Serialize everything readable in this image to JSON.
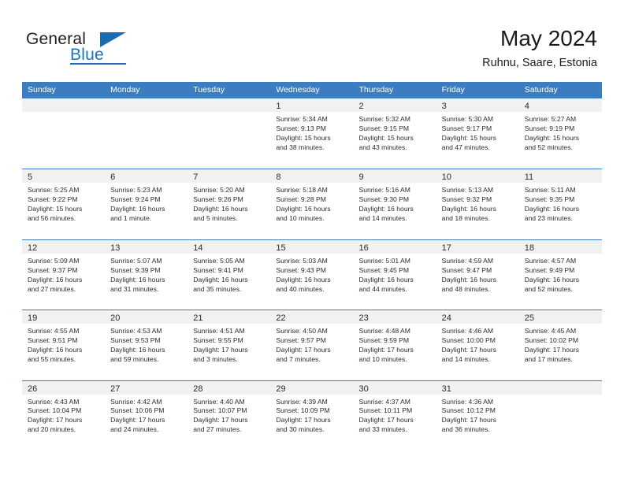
{
  "brand": {
    "name_top": "General",
    "name_bottom": "Blue",
    "accent_color": "#1b6cb0"
  },
  "header": {
    "month_title": "May 2024",
    "location": "Ruhnu, Saare, Estonia"
  },
  "theme": {
    "header_blue": "#3b7dc0",
    "day_band_gray": "#f1f1f1",
    "text": "#2b2b2b"
  },
  "weekdays": [
    "Sunday",
    "Monday",
    "Tuesday",
    "Wednesday",
    "Thursday",
    "Friday",
    "Saturday"
  ],
  "weeks": [
    [
      {
        "day": "",
        "sunrise": "",
        "sunset": "",
        "daylight_1": "",
        "daylight_2": ""
      },
      {
        "day": "",
        "sunrise": "",
        "sunset": "",
        "daylight_1": "",
        "daylight_2": ""
      },
      {
        "day": "",
        "sunrise": "",
        "sunset": "",
        "daylight_1": "",
        "daylight_2": ""
      },
      {
        "day": "1",
        "sunrise": "Sunrise: 5:34 AM",
        "sunset": "Sunset: 9:13 PM",
        "daylight_1": "Daylight: 15 hours",
        "daylight_2": "and 38 minutes."
      },
      {
        "day": "2",
        "sunrise": "Sunrise: 5:32 AM",
        "sunset": "Sunset: 9:15 PM",
        "daylight_1": "Daylight: 15 hours",
        "daylight_2": "and 43 minutes."
      },
      {
        "day": "3",
        "sunrise": "Sunrise: 5:30 AM",
        "sunset": "Sunset: 9:17 PM",
        "daylight_1": "Daylight: 15 hours",
        "daylight_2": "and 47 minutes."
      },
      {
        "day": "4",
        "sunrise": "Sunrise: 5:27 AM",
        "sunset": "Sunset: 9:19 PM",
        "daylight_1": "Daylight: 15 hours",
        "daylight_2": "and 52 minutes."
      }
    ],
    [
      {
        "day": "5",
        "sunrise": "Sunrise: 5:25 AM",
        "sunset": "Sunset: 9:22 PM",
        "daylight_1": "Daylight: 15 hours",
        "daylight_2": "and 56 minutes."
      },
      {
        "day": "6",
        "sunrise": "Sunrise: 5:23 AM",
        "sunset": "Sunset: 9:24 PM",
        "daylight_1": "Daylight: 16 hours",
        "daylight_2": "and 1 minute."
      },
      {
        "day": "7",
        "sunrise": "Sunrise: 5:20 AM",
        "sunset": "Sunset: 9:26 PM",
        "daylight_1": "Daylight: 16 hours",
        "daylight_2": "and 5 minutes."
      },
      {
        "day": "8",
        "sunrise": "Sunrise: 5:18 AM",
        "sunset": "Sunset: 9:28 PM",
        "daylight_1": "Daylight: 16 hours",
        "daylight_2": "and 10 minutes."
      },
      {
        "day": "9",
        "sunrise": "Sunrise: 5:16 AM",
        "sunset": "Sunset: 9:30 PM",
        "daylight_1": "Daylight: 16 hours",
        "daylight_2": "and 14 minutes."
      },
      {
        "day": "10",
        "sunrise": "Sunrise: 5:13 AM",
        "sunset": "Sunset: 9:32 PM",
        "daylight_1": "Daylight: 16 hours",
        "daylight_2": "and 18 minutes."
      },
      {
        "day": "11",
        "sunrise": "Sunrise: 5:11 AM",
        "sunset": "Sunset: 9:35 PM",
        "daylight_1": "Daylight: 16 hours",
        "daylight_2": "and 23 minutes."
      }
    ],
    [
      {
        "day": "12",
        "sunrise": "Sunrise: 5:09 AM",
        "sunset": "Sunset: 9:37 PM",
        "daylight_1": "Daylight: 16 hours",
        "daylight_2": "and 27 minutes."
      },
      {
        "day": "13",
        "sunrise": "Sunrise: 5:07 AM",
        "sunset": "Sunset: 9:39 PM",
        "daylight_1": "Daylight: 16 hours",
        "daylight_2": "and 31 minutes."
      },
      {
        "day": "14",
        "sunrise": "Sunrise: 5:05 AM",
        "sunset": "Sunset: 9:41 PM",
        "daylight_1": "Daylight: 16 hours",
        "daylight_2": "and 35 minutes."
      },
      {
        "day": "15",
        "sunrise": "Sunrise: 5:03 AM",
        "sunset": "Sunset: 9:43 PM",
        "daylight_1": "Daylight: 16 hours",
        "daylight_2": "and 40 minutes."
      },
      {
        "day": "16",
        "sunrise": "Sunrise: 5:01 AM",
        "sunset": "Sunset: 9:45 PM",
        "daylight_1": "Daylight: 16 hours",
        "daylight_2": "and 44 minutes."
      },
      {
        "day": "17",
        "sunrise": "Sunrise: 4:59 AM",
        "sunset": "Sunset: 9:47 PM",
        "daylight_1": "Daylight: 16 hours",
        "daylight_2": "and 48 minutes."
      },
      {
        "day": "18",
        "sunrise": "Sunrise: 4:57 AM",
        "sunset": "Sunset: 9:49 PM",
        "daylight_1": "Daylight: 16 hours",
        "daylight_2": "and 52 minutes."
      }
    ],
    [
      {
        "day": "19",
        "sunrise": "Sunrise: 4:55 AM",
        "sunset": "Sunset: 9:51 PM",
        "daylight_1": "Daylight: 16 hours",
        "daylight_2": "and 55 minutes."
      },
      {
        "day": "20",
        "sunrise": "Sunrise: 4:53 AM",
        "sunset": "Sunset: 9:53 PM",
        "daylight_1": "Daylight: 16 hours",
        "daylight_2": "and 59 minutes."
      },
      {
        "day": "21",
        "sunrise": "Sunrise: 4:51 AM",
        "sunset": "Sunset: 9:55 PM",
        "daylight_1": "Daylight: 17 hours",
        "daylight_2": "and 3 minutes."
      },
      {
        "day": "22",
        "sunrise": "Sunrise: 4:50 AM",
        "sunset": "Sunset: 9:57 PM",
        "daylight_1": "Daylight: 17 hours",
        "daylight_2": "and 7 minutes."
      },
      {
        "day": "23",
        "sunrise": "Sunrise: 4:48 AM",
        "sunset": "Sunset: 9:59 PM",
        "daylight_1": "Daylight: 17 hours",
        "daylight_2": "and 10 minutes."
      },
      {
        "day": "24",
        "sunrise": "Sunrise: 4:46 AM",
        "sunset": "Sunset: 10:00 PM",
        "daylight_1": "Daylight: 17 hours",
        "daylight_2": "and 14 minutes."
      },
      {
        "day": "25",
        "sunrise": "Sunrise: 4:45 AM",
        "sunset": "Sunset: 10:02 PM",
        "daylight_1": "Daylight: 17 hours",
        "daylight_2": "and 17 minutes."
      }
    ],
    [
      {
        "day": "26",
        "sunrise": "Sunrise: 4:43 AM",
        "sunset": "Sunset: 10:04 PM",
        "daylight_1": "Daylight: 17 hours",
        "daylight_2": "and 20 minutes."
      },
      {
        "day": "27",
        "sunrise": "Sunrise: 4:42 AM",
        "sunset": "Sunset: 10:06 PM",
        "daylight_1": "Daylight: 17 hours",
        "daylight_2": "and 24 minutes."
      },
      {
        "day": "28",
        "sunrise": "Sunrise: 4:40 AM",
        "sunset": "Sunset: 10:07 PM",
        "daylight_1": "Daylight: 17 hours",
        "daylight_2": "and 27 minutes."
      },
      {
        "day": "29",
        "sunrise": "Sunrise: 4:39 AM",
        "sunset": "Sunset: 10:09 PM",
        "daylight_1": "Daylight: 17 hours",
        "daylight_2": "and 30 minutes."
      },
      {
        "day": "30",
        "sunrise": "Sunrise: 4:37 AM",
        "sunset": "Sunset: 10:11 PM",
        "daylight_1": "Daylight: 17 hours",
        "daylight_2": "and 33 minutes."
      },
      {
        "day": "31",
        "sunrise": "Sunrise: 4:36 AM",
        "sunset": "Sunset: 10:12 PM",
        "daylight_1": "Daylight: 17 hours",
        "daylight_2": "and 36 minutes."
      },
      {
        "day": "",
        "sunrise": "",
        "sunset": "",
        "daylight_1": "",
        "daylight_2": ""
      }
    ]
  ]
}
